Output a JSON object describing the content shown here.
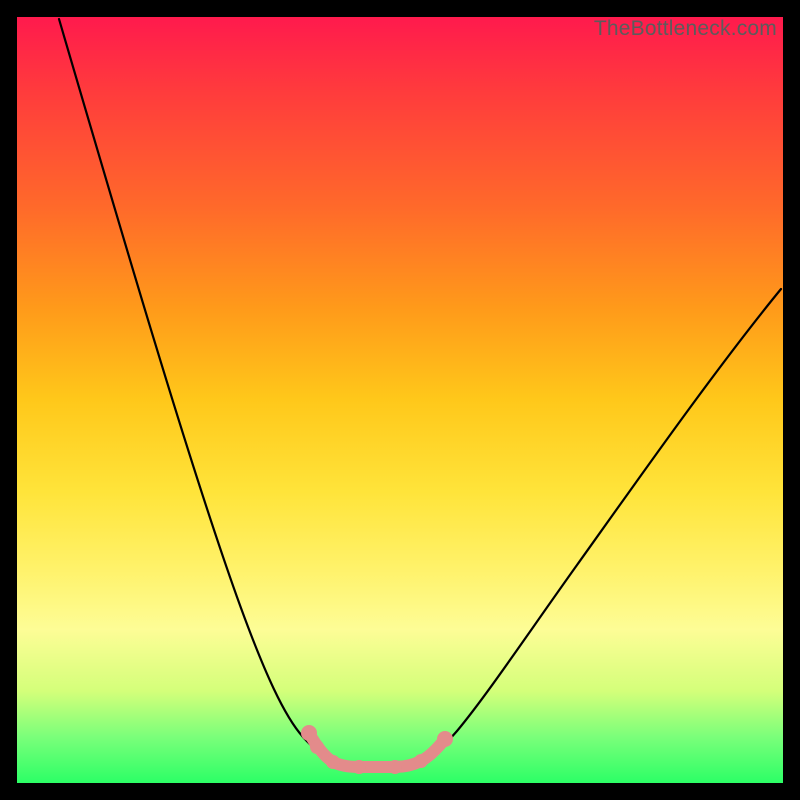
{
  "watermark": "TheBottleneck.com",
  "colors": {
    "background_outer": "#000000",
    "gradient_top": "#ff1a4d",
    "gradient_mid": "#ffe43a",
    "gradient_bottom": "#2cff66",
    "curve": "#000000",
    "highlight": "#e38b8b"
  },
  "chart_data": {
    "type": "line",
    "title": "",
    "xlabel": "",
    "ylabel": "",
    "xlim": [
      0,
      100
    ],
    "ylim": [
      0,
      100
    ],
    "grid": false,
    "legend": false,
    "background": "vertical-gradient-red-to-green",
    "series": [
      {
        "name": "bottleneck-curve",
        "color": "#000000",
        "x": [
          5,
          12,
          20,
          28,
          34,
          38,
          41,
          44,
          47,
          50,
          53,
          58,
          65,
          73,
          82,
          92,
          100
        ],
        "y": [
          100,
          78,
          56,
          38,
          24,
          14,
          8,
          4,
          2,
          2,
          4,
          8,
          18,
          32,
          46,
          58,
          65
        ]
      }
    ],
    "annotations": [
      {
        "name": "optimal-range-highlight",
        "type": "segment-overlay",
        "color": "#e38b8b",
        "x": [
          38,
          40,
          42,
          45,
          49,
          53,
          56
        ],
        "y": [
          6,
          4,
          2,
          2,
          2,
          4,
          6
        ]
      }
    ],
    "notes": "Curve shape only — no axis ticks, labels, or numeric scales are rendered in the image; x/y are estimated on a 0–100 normalized grid. Background gradient encodes bottleneck severity (red high → green low). Pink overlay marks the flat trough (best-match region)."
  }
}
